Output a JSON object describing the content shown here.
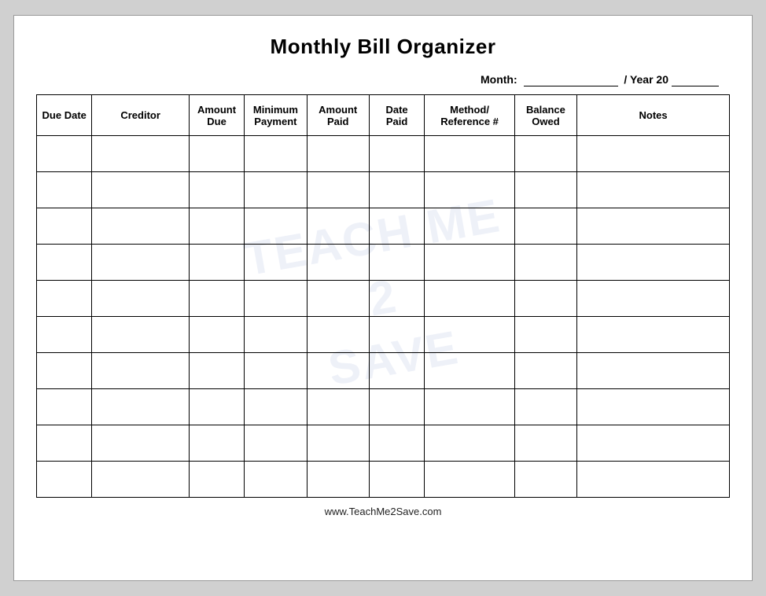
{
  "title": "Monthly Bill Organizer",
  "month_label": "Month:",
  "year_label": "/ Year 20",
  "columns": [
    {
      "key": "due_date",
      "lines": [
        "Due Date"
      ]
    },
    {
      "key": "creditor",
      "lines": [
        "Creditor"
      ]
    },
    {
      "key": "amount_due",
      "lines": [
        "Amount",
        "Due"
      ]
    },
    {
      "key": "min_payment",
      "lines": [
        "Minimum",
        "Payment"
      ]
    },
    {
      "key": "amount_paid",
      "lines": [
        "Amount",
        "Paid"
      ]
    },
    {
      "key": "date_paid",
      "lines": [
        "Date",
        "Paid"
      ]
    },
    {
      "key": "method_ref",
      "lines": [
        "Method/",
        "Reference #"
      ]
    },
    {
      "key": "balance_owed",
      "lines": [
        "Balance",
        "Owed"
      ]
    },
    {
      "key": "notes",
      "lines": [
        "Notes"
      ]
    }
  ],
  "row_count": 10,
  "footer": "www.TeachMe2Save.com",
  "watermark_lines": [
    "TEACH ME",
    "2",
    "SAVE"
  ]
}
